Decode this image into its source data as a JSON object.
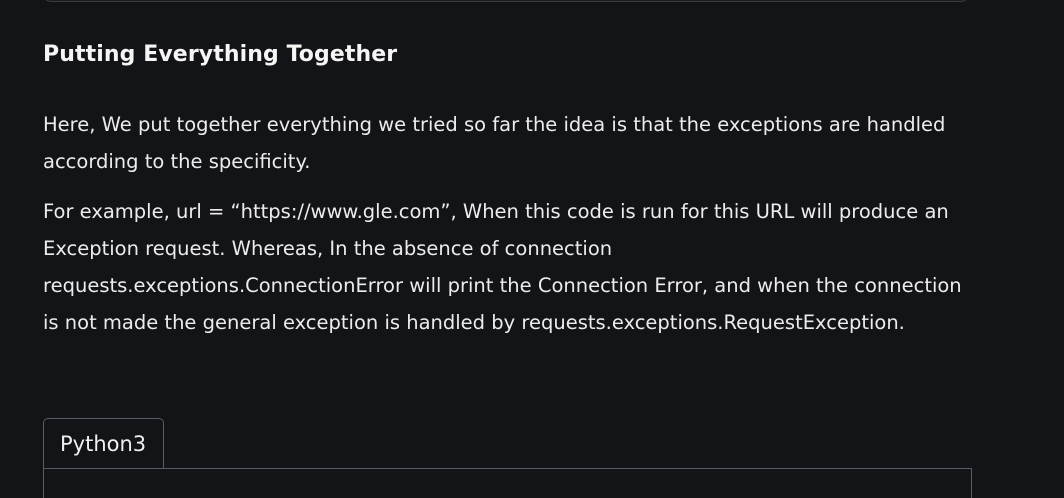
{
  "article": {
    "section_title": "Putting Everything Together",
    "paragraph_1": "Here, We put together everything we tried so far the idea is that the exceptions are handled according to the specificity.",
    "paragraph_2": "For example, url =  “https://www.gle.com”,  When this code is run for this URL will produce an Exception request. Whereas, In the absence of connection requests.exceptions.ConnectionError will print the Connection Error, and when the connection is not made the general exception is handled by requests.exceptions.RequestException."
  },
  "code_block": {
    "tab_label": "Python3"
  }
}
